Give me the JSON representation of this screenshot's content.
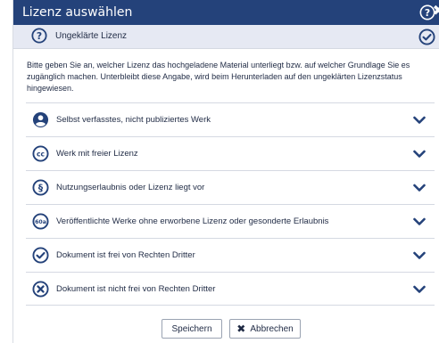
{
  "dialog": {
    "title": "Lizenz auswählen",
    "close_glyph": "✖",
    "help_icon": "help-circle-icon"
  },
  "selected": {
    "label": "Ungeklärte Lizenz",
    "icon": "question-circle-icon",
    "check_icon": "check-circle-icon"
  },
  "description": "Bitte geben Sie an, welcher Lizenz das hochgeladene Material unterliegt bzw. auf welcher Grundlage Sie es zugänglich machen. Unterbleibt diese Angabe, wird beim Herunterladen auf den ungeklärten Lizenzstatus hingewiesen.",
  "options": [
    {
      "label": "Selbst verfasstes, nicht publiziertes Werk",
      "icon": "user-circle-icon"
    },
    {
      "label": "Werk mit freier Lizenz",
      "icon": "creative-commons-icon"
    },
    {
      "label": "Nutzungserlaubnis oder Lizenz liegt vor",
      "icon": "paragraph-icon"
    },
    {
      "label": "Veröffentlichte Werke ohne erworbene Lizenz oder gesonderte Erlaubnis",
      "icon": "60a-icon",
      "icon_text": "60a"
    },
    {
      "label": "Dokument ist frei von Rechten Dritter",
      "icon": "check-circle-icon"
    },
    {
      "label": "Dokument ist nicht frei von Rechten Dritter",
      "icon": "x-circle-icon"
    }
  ],
  "footer": {
    "save_label": "Speichern",
    "cancel_label": "Abbrechen",
    "cancel_glyph": "✖"
  },
  "colors": {
    "titlebar": "#24427a",
    "accent": "#24427a",
    "selected_bg": "#e6e9f3"
  }
}
